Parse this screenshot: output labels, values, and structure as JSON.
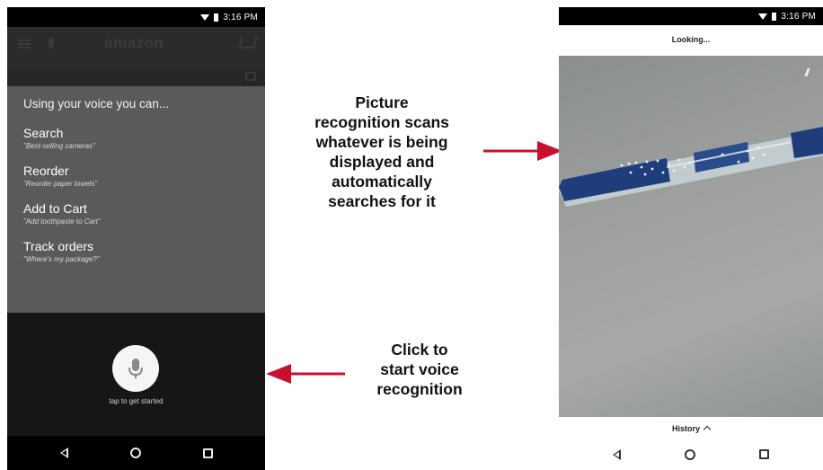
{
  "left_phone": {
    "status": {
      "time": "3:16 PM"
    },
    "header": {
      "logo": "amazon"
    },
    "voice_panel": {
      "title": "Using your voice you can...",
      "commands": [
        {
          "name": "Search",
          "example": "\"Best-selling cameras\""
        },
        {
          "name": "Reorder",
          "example": "\"Reorder paper towels\""
        },
        {
          "name": "Add to Cart",
          "example": "\"Add toothpaste to Cart\""
        },
        {
          "name": "Track orders",
          "example": "\"Where's my package?\""
        }
      ]
    },
    "mic": {
      "label": "tap to get started"
    }
  },
  "right_phone": {
    "status": {
      "time": "3:16 PM"
    },
    "top_label": "Looking...",
    "bottom_label": "History"
  },
  "annotations": {
    "picture": [
      "Picture",
      "recognition scans",
      "whatever is being",
      "displayed and",
      "automatically",
      "searches for it"
    ],
    "voice": [
      "Click to",
      "start voice",
      "recognition"
    ]
  },
  "colors": {
    "arrow": "#c8102e",
    "pen_blue": "#1f3d7a",
    "overlay": "#5a5a5a"
  }
}
